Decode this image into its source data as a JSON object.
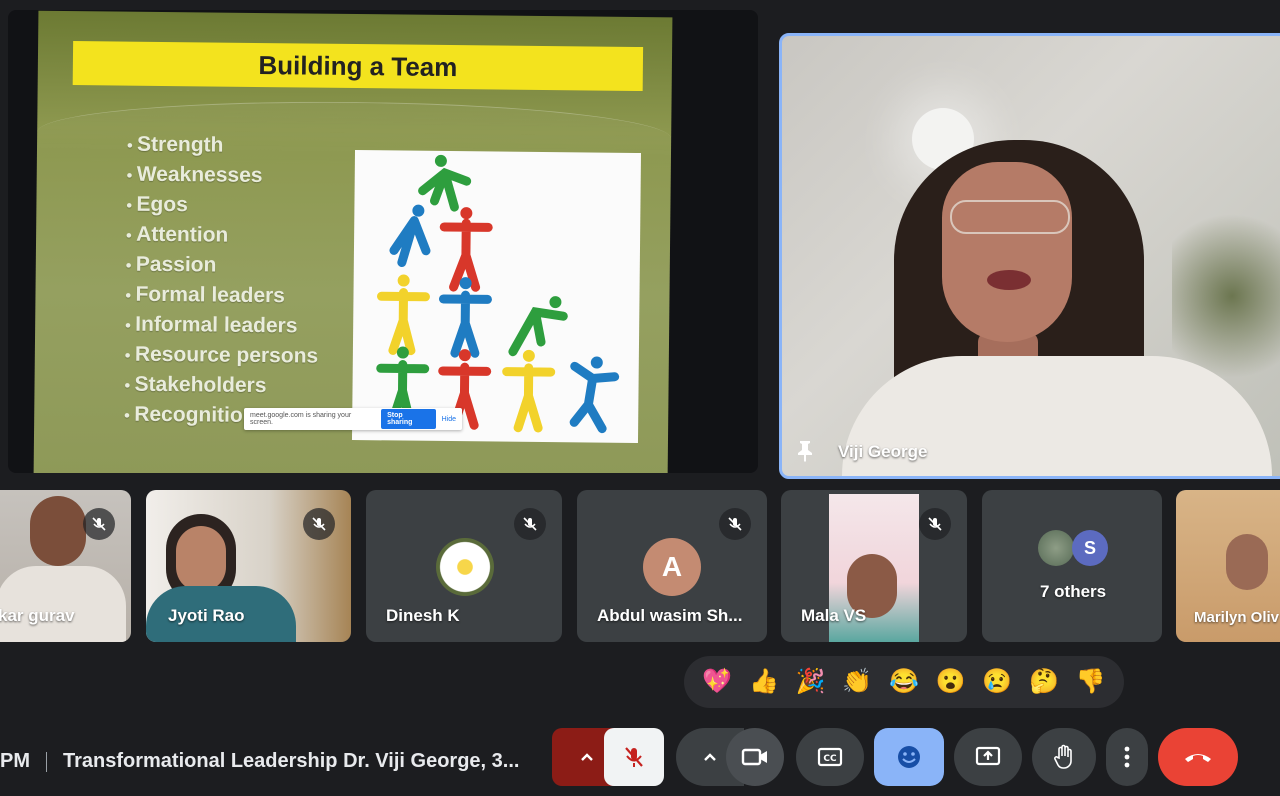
{
  "slide": {
    "title": "Building a Team",
    "bullets": [
      "Strength",
      "Weaknesses",
      "Egos",
      "Attention",
      "Passion",
      "Formal leaders",
      "Informal leaders",
      "Resource persons",
      "Stakeholders",
      "Recognition"
    ],
    "share_bar": {
      "message": "meet.google.com is sharing your screen.",
      "stop_label": "Stop sharing",
      "hide_label": "Hide"
    }
  },
  "speaker": {
    "name": "Viji George",
    "pinned": true
  },
  "participants": [
    {
      "name": "kar gurav",
      "muted": true
    },
    {
      "name": "Jyoti Rao",
      "muted": true
    },
    {
      "name": "Dinesh K",
      "muted": true
    },
    {
      "name": "Abdul wasim Sh...",
      "initial": "A",
      "muted": true
    },
    {
      "name": "Mala VS",
      "muted": true
    },
    {
      "name": "7 others",
      "initial": "S"
    },
    {
      "name": "Marilyn Oliv"
    }
  ],
  "reactions": [
    "💖",
    "👍",
    "🎉",
    "👏",
    "😂",
    "😮",
    "😢",
    "🤔",
    "👎"
  ],
  "meeting": {
    "time_fragment": "PM",
    "title": "Transformational Leadership Dr. Viji George, 3..."
  },
  "controls": {
    "items": [
      "more-audio-options",
      "microphone-off",
      "more-video-options",
      "camera",
      "captions",
      "emoji-reactions",
      "present-screen",
      "raise-hand",
      "more-options",
      "leave-call"
    ]
  },
  "colors": {
    "leave": "#ea4335",
    "active_blue": "#8ab4f8",
    "mic_off_red": "#8c1c16",
    "slide_title_bg": "#f3e31e"
  }
}
